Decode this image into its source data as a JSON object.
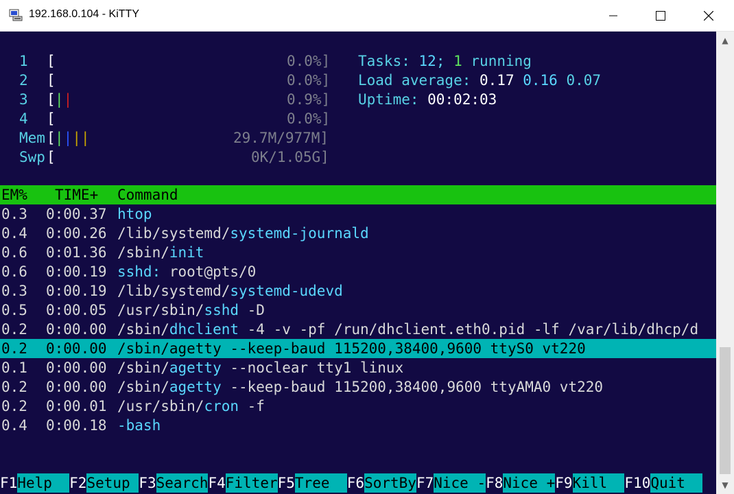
{
  "window": {
    "title": "192.168.0.104 - KiTTY",
    "icon": "kitty-terminal-icon",
    "controls": [
      "minimize",
      "maximize",
      "close"
    ]
  },
  "meters": {
    "cpus": [
      {
        "label": "1",
        "value": "0.0%]"
      },
      {
        "label": "2",
        "value": "0.0%]"
      },
      {
        "label": "3",
        "value": "0.9%]"
      },
      {
        "label": "4",
        "value": "0.0%]"
      }
    ],
    "mem": {
      "label": "Mem",
      "value": "29.7M/977M]"
    },
    "swp": {
      "label": "Swp",
      "value": "0K/1.05G]"
    }
  },
  "summary": {
    "tasks_label": "Tasks: ",
    "tasks_count": "12",
    "tasks_sep": "; ",
    "running_count": "1",
    "running_label": " running",
    "load_label": "Load average: ",
    "load1": "0.17",
    "load5": "0.16",
    "load15": "0.07",
    "uptime_label": "Uptime: ",
    "uptime_value": "00:02:03"
  },
  "table": {
    "columns": {
      "mem": "EM%",
      "time": "TIME+",
      "command": "Command"
    },
    "rows": [
      {
        "mem": "0.3",
        "time": "0:00.37",
        "cmd_prefix": "",
        "cmd_name": "htop",
        "cmd_args": ""
      },
      {
        "mem": "0.4",
        "time": "0:00.26",
        "cmd_prefix": "/lib/systemd/",
        "cmd_name": "systemd-journald",
        "cmd_args": ""
      },
      {
        "mem": "0.6",
        "time": "0:01.36",
        "cmd_prefix": "/sbin/",
        "cmd_name": "init",
        "cmd_args": ""
      },
      {
        "mem": "0.6",
        "time": "0:00.19",
        "cmd_prefix": "",
        "cmd_name": "sshd:",
        "cmd_args": " root@pts/0"
      },
      {
        "mem": "0.3",
        "time": "0:00.19",
        "cmd_prefix": "/lib/systemd/",
        "cmd_name": "systemd-udevd",
        "cmd_args": ""
      },
      {
        "mem": "0.5",
        "time": "0:00.05",
        "cmd_prefix": "/usr/sbin/",
        "cmd_name": "sshd",
        "cmd_args": " -D"
      },
      {
        "mem": "0.2",
        "time": "0:00.00",
        "cmd_prefix": "/sbin/",
        "cmd_name": "dhclient",
        "cmd_args": " -4 -v -pf /run/dhclient.eth0.pid -lf /var/lib/dhcp/d"
      },
      {
        "mem": "0.2",
        "time": "0:00.00",
        "cmd_prefix": "/sbin/",
        "cmd_name": "agetty",
        "cmd_args": " --keep-baud 115200,38400,9600 ttyS0 vt220"
      },
      {
        "mem": "0.1",
        "time": "0:00.00",
        "cmd_prefix": "/sbin/",
        "cmd_name": "agetty",
        "cmd_args": " --noclear tty1 linux"
      },
      {
        "mem": "0.2",
        "time": "0:00.00",
        "cmd_prefix": "/sbin/",
        "cmd_name": "agetty",
        "cmd_args": " --keep-baud 115200,38400,9600 ttyAMA0 vt220"
      },
      {
        "mem": "0.2",
        "time": "0:00.01",
        "cmd_prefix": "/usr/sbin/",
        "cmd_name": "cron",
        "cmd_args": " -f"
      },
      {
        "mem": "0.4",
        "time": "0:00.18",
        "cmd_prefix": "",
        "cmd_name": "-bash",
        "cmd_args": ""
      }
    ],
    "selected_row": "8"
  },
  "function_keys": [
    {
      "key": "F1",
      "label": "Help  "
    },
    {
      "key": "F2",
      "label": "Setup "
    },
    {
      "key": "F3",
      "label": "Search"
    },
    {
      "key": "F4",
      "label": "Filter"
    },
    {
      "key": "F5",
      "label": "Tree  "
    },
    {
      "key": "F6",
      "label": "SortBy"
    },
    {
      "key": "F7",
      "label": "Nice -"
    },
    {
      "key": "F8",
      "label": "Nice +"
    },
    {
      "key": "F9",
      "label": "Kill  "
    },
    {
      "key": "F10",
      "label": "Quit  "
    }
  ],
  "colors": {
    "terminal_bg": "#120a43",
    "header_bg": "#18c210",
    "selection_bg": "#00b4b4",
    "accent_text": "#5ad8ff"
  }
}
